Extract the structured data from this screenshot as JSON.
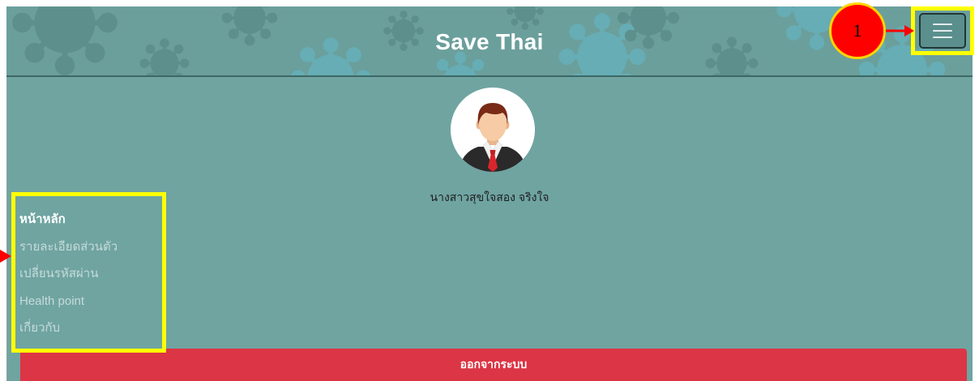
{
  "app": {
    "title": "Save Thai"
  },
  "header": {
    "menu_button": {
      "icon": "hamburger-menu-icon"
    }
  },
  "profile": {
    "name": "นางสาวสุขใจสอง จริงใจ",
    "avatar": "user-avatar-icon"
  },
  "nav": {
    "items": [
      {
        "label": "หน้าหลัก",
        "active": true
      },
      {
        "label": "รายละเอียดส่วนตัว",
        "active": false
      },
      {
        "label": "เปลี่ยนรหัสผ่าน",
        "active": false
      },
      {
        "label": "Health point",
        "active": false
      },
      {
        "label": "เกี่ยวกับ",
        "active": false
      }
    ]
  },
  "logout_button": {
    "label": "ออกจากระบบ"
  },
  "annotation": {
    "step_marker": "1"
  },
  "colors": {
    "header_bg": "#6b9f9c",
    "panel_bg": "#6fa4a1",
    "logout_bg": "#dc3545",
    "highlight": "#ffff00",
    "marker": "#ff0000"
  }
}
